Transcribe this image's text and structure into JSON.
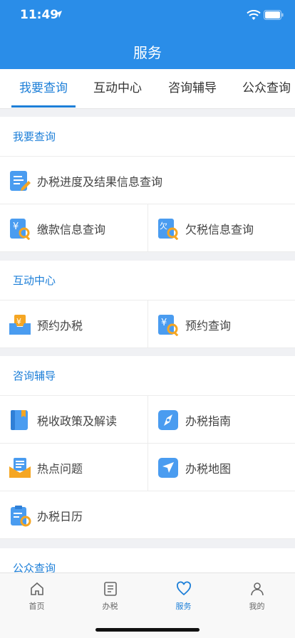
{
  "status": {
    "time": "11:49"
  },
  "header": {
    "title": "服务"
  },
  "tabs": [
    {
      "label": "我要查询",
      "active": true
    },
    {
      "label": "互动中心",
      "active": false
    },
    {
      "label": "咨询辅导",
      "active": false
    },
    {
      "label": "公众查询",
      "active": false
    }
  ],
  "sections": {
    "query": {
      "title": "我要查询",
      "items": [
        {
          "label": "办税进度及结果信息查询",
          "icon": "document-edit-icon"
        },
        {
          "label": "缴款信息查询",
          "icon": "yuan-search-icon"
        },
        {
          "label": "欠税信息查询",
          "icon": "owed-search-icon"
        }
      ]
    },
    "interact": {
      "title": "互动中心",
      "items": [
        {
          "label": "预约办税",
          "icon": "inbox-yuan-icon"
        },
        {
          "label": "预约查询",
          "icon": "yuan-search-icon"
        }
      ]
    },
    "consult": {
      "title": "咨询辅导",
      "items": [
        {
          "label": "税收政策及解读",
          "icon": "book-icon"
        },
        {
          "label": "办税指南",
          "icon": "compass-icon"
        },
        {
          "label": "热点问题",
          "icon": "mail-list-icon"
        },
        {
          "label": "办税地图",
          "icon": "map-arrow-icon"
        },
        {
          "label": "办税日历",
          "icon": "calendar-refresh-icon"
        }
      ]
    },
    "public": {
      "title": "公众查询"
    }
  },
  "tabbar": [
    {
      "label": "首页",
      "icon": "home-icon",
      "active": false
    },
    {
      "label": "办税",
      "icon": "list-icon",
      "active": false
    },
    {
      "label": "服务",
      "icon": "heart-icon",
      "active": true
    },
    {
      "label": "我的",
      "icon": "user-icon",
      "active": false
    }
  ],
  "colors": {
    "header": "#2a8de8",
    "accent": "#1d7fd8",
    "icon_blue": "#4a9cf0",
    "icon_orange": "#f5a623"
  }
}
